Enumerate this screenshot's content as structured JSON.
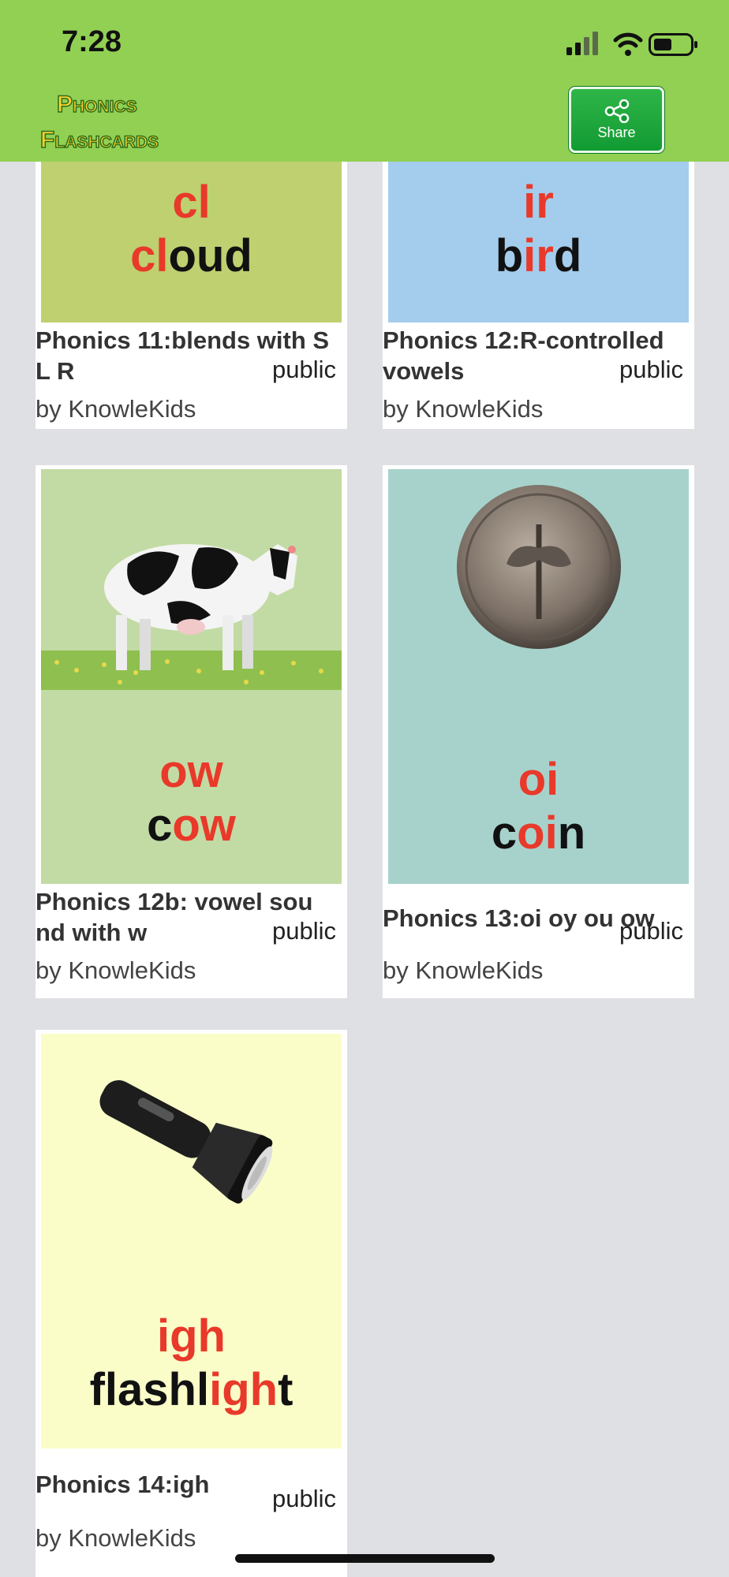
{
  "status": {
    "time": "7:28"
  },
  "app": {
    "logo_line1": "Phonics",
    "logo_line2": "Flashcards",
    "share_label": "Share"
  },
  "cards": [
    {
      "symbol": "cl",
      "word_hl": "cl",
      "word_rest": "oud",
      "title": "Phonics 11:blends with S L R",
      "visibility": "public",
      "author": "by KnowleKids",
      "bg": "#bed070"
    },
    {
      "symbol": "ir",
      "word_pre": "b",
      "word_hl": "ir",
      "word_post": "d",
      "title": "Phonics 12:R-controlled vowels",
      "visibility": "public",
      "author": "by KnowleKids",
      "bg": "#a4ccec"
    },
    {
      "symbol": "ow",
      "word_pre": "c",
      "word_hl": "ow",
      "title": "Phonics 12b: vowel sou nd with w",
      "visibility": "public",
      "author": "by KnowleKids",
      "bg": "#c2dba4",
      "image": "cow"
    },
    {
      "symbol": "oi",
      "word_pre": "c",
      "word_hl": "oi",
      "word_post": "n",
      "title": "Phonics 13:oi oy ou ow",
      "visibility": "public",
      "author": "by KnowleKids",
      "bg": "#a7d2cc",
      "image": "dime coin"
    },
    {
      "symbol": "igh",
      "word_pre": "flashl",
      "word_hl": "igh",
      "word_post": "t",
      "title": "Phonics 14:igh",
      "visibility": "public",
      "author": "by KnowleKids",
      "bg": "#fafdc8",
      "image": "flashlight"
    }
  ]
}
